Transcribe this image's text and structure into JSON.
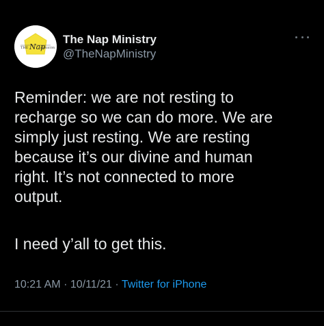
{
  "tweet": {
    "display_name": "The Nap Ministry",
    "handle": "@TheNapMinistry",
    "avatar": {
      "icon": "nap-ministry-logo",
      "text_left": "THE",
      "text_center": "Nap",
      "text_right": "MINISTRY",
      "accent_color": "#f5e23a"
    },
    "text_paragraph_1": "Reminder: we are not resting to\nrecharge so we can do more. We are\nsimply just resting. We are resting\nbecause it’s our divine and human\nright. It’s not connected to more\noutput.",
    "text_paragraph_2": "I need y’all to get this.",
    "time": "10:21 AM",
    "separator": "·",
    "date": "10/11/21",
    "source": "Twitter for iPhone",
    "more_icon": "more-horizontal-icon"
  },
  "colors": {
    "background": "#000000",
    "primary_text": "#e7e9ea",
    "secondary_text": "#8b98a5",
    "link": "#1d9bf0"
  }
}
